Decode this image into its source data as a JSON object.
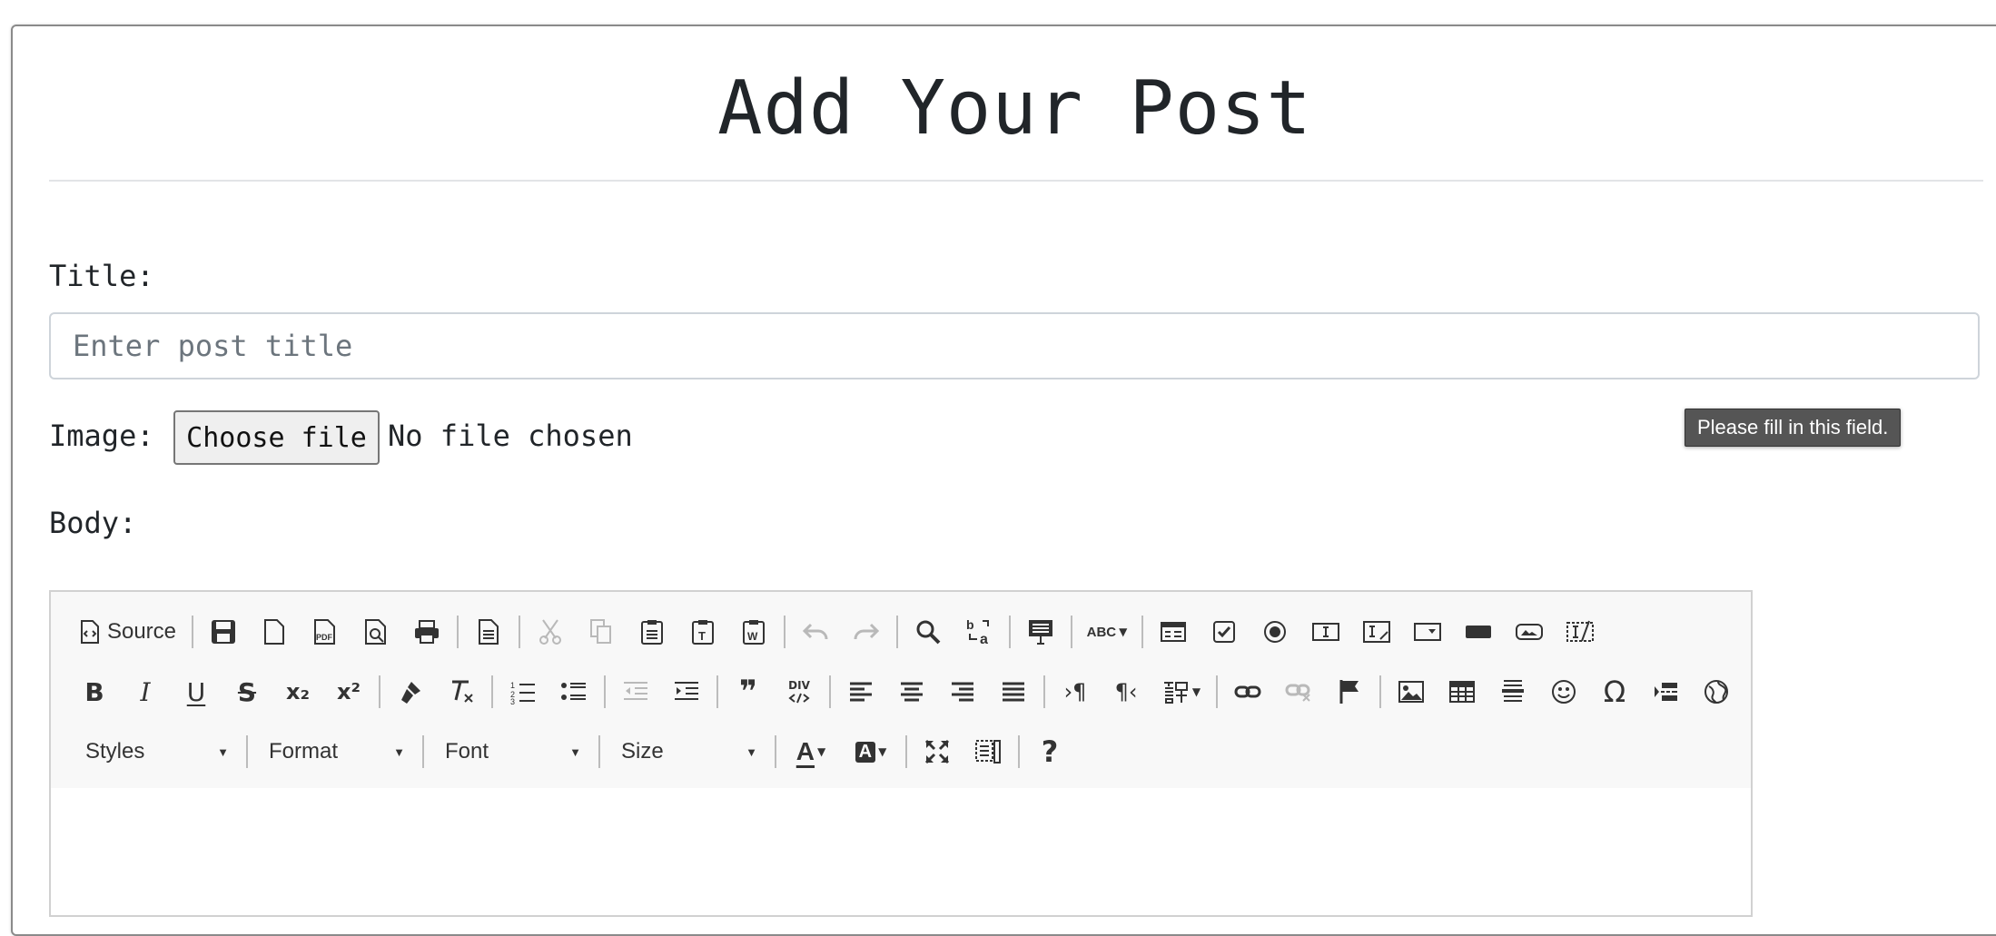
{
  "page": {
    "title": "Add Your Post"
  },
  "form": {
    "title_label": "Title:",
    "title_placeholder": "Enter post title",
    "title_value": "",
    "image_label": "Image:",
    "file_button": "Choose file",
    "file_status": "No file chosen",
    "body_label": "Body:",
    "validation_tooltip": "Please fill in this field."
  },
  "editor": {
    "source_label": "Source",
    "combos": {
      "styles": "Styles",
      "format": "Format",
      "font": "Font",
      "size": "Size"
    },
    "glyphs": {
      "bold": "B",
      "italic": "I",
      "underline": "U",
      "strike": "S",
      "subscript": "x₂",
      "superscript": "x²",
      "quote": "❞",
      "div": "DIV",
      "special_char": "Ω",
      "help": "?",
      "text_color": "A",
      "bg_color": "A",
      "spellcheck": "ABC"
    }
  }
}
